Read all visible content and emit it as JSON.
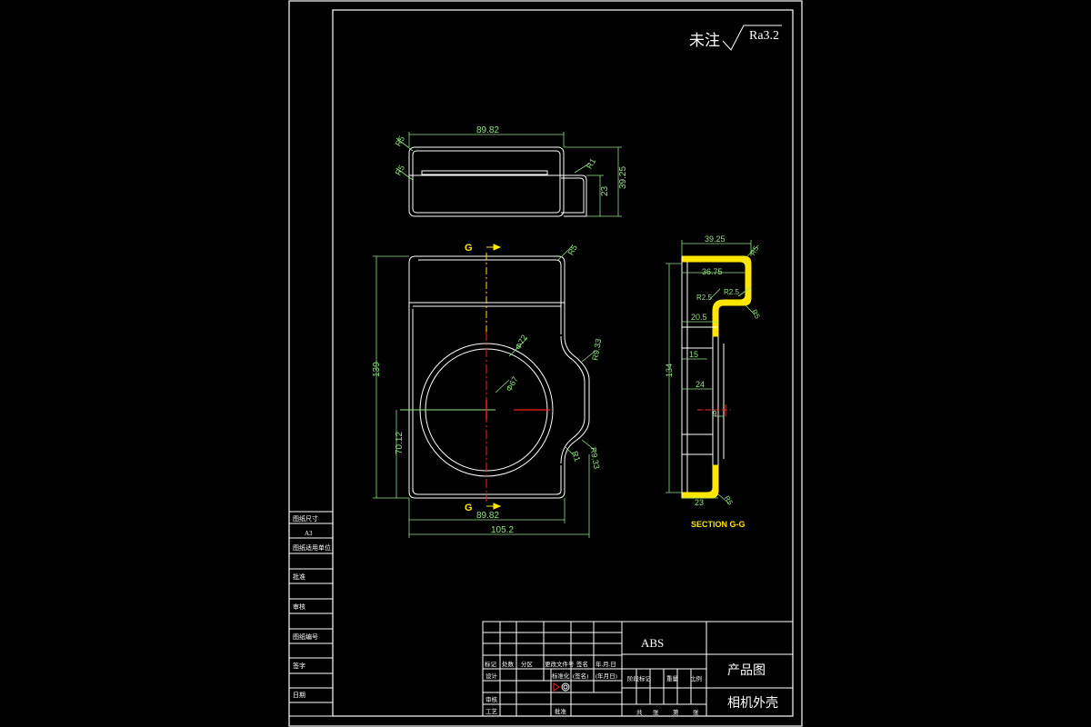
{
  "surface_note": {
    "prefix": "未注",
    "roughness": "Ra3.2"
  },
  "top_view": {
    "width": "89.82",
    "radius_left_top": "R5",
    "radius_left_mid": "R5",
    "radius_right": "R1",
    "height_total": "39.25",
    "height_step": "23"
  },
  "front_view": {
    "section_mark": "G",
    "radius_corner": "R5",
    "hole_outer": "Φ72",
    "hole_inner": "Φ67",
    "notch_top_radius": "R9.33",
    "notch_bottom_radius": "R9.33",
    "notch_small_radius": "R1",
    "height_total": "139",
    "height_lower": "70.12",
    "width_inner": "89.82",
    "width_total": "105.2"
  },
  "section_view": {
    "title": "SECTION G-G",
    "dims": [
      "39.25",
      "36.75",
      "20.5",
      "15",
      "24",
      "23",
      "134"
    ],
    "radii": [
      "R5",
      "R2.5",
      "R2.5",
      "R5",
      "R5"
    ],
    "small_dim": "9"
  },
  "left_strip": {
    "rows": [
      "图纸尺寸",
      "A3",
      "图纸适用单位",
      "批准",
      "审核",
      "图纸编号",
      "签字",
      "日期"
    ]
  },
  "title_block": {
    "material": "ABS",
    "drawing_type": "产品图",
    "part_name": "相机外壳",
    "header_cells": [
      "标记",
      "处数",
      "分区",
      "更改文件号",
      "签名",
      "年.月.日"
    ],
    "row_labels": [
      "设计",
      "审核",
      "工艺"
    ],
    "std_label": "标准化",
    "approve_label": "批准",
    "mid_cells": [
      "(签名)",
      "(年月日)"
    ],
    "stage_cells": [
      "阶段标记",
      "重量",
      "比例"
    ],
    "sheet_cells": [
      "共",
      "张",
      "第",
      "张"
    ]
  },
  "colors": {
    "outline": "#ffffff",
    "dimension": "#8fe37f",
    "center": "#ff2020",
    "yellow": "#ffe600"
  }
}
